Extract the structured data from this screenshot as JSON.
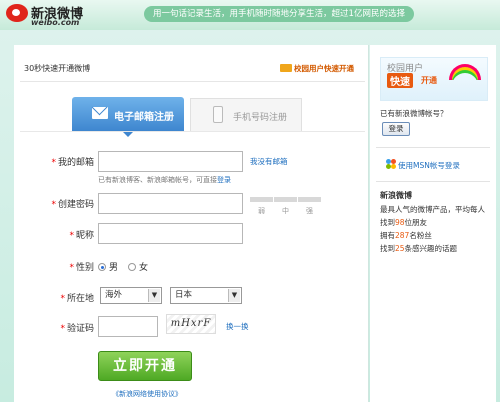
{
  "brand": {
    "name_cn": "新浪微博",
    "domain": "weibo.com",
    "slogan": "用一句话记录生活，用手机随时随地分享生活，超过1亿网民的选择"
  },
  "colors": {
    "accent_blue": "#3e86cf",
    "submit_green": "#4ea924",
    "required_red": "#e00000",
    "link_blue": "#1f6fbf",
    "highlight_orange": "#e85a10"
  },
  "header": {
    "title": "30秒快速开通微博",
    "campus_link": "校园用户快速开通",
    "campus_icon": "flag-icon"
  },
  "tabs": [
    {
      "label": "电子邮箱注册",
      "icon": "envelope-icon",
      "active": true
    },
    {
      "label": "手机号码注册",
      "icon": "mobile-phone-icon",
      "active": false
    }
  ],
  "form": {
    "email": {
      "label": "我的邮箱",
      "value": "",
      "no_email_link": "我没有邮箱",
      "hint": "已有新浪博客、新浪邮箱帐号，可直接",
      "hint_login": "登录"
    },
    "password": {
      "label": "创建密码",
      "value": "",
      "strength": [
        "弱",
        "中",
        "强"
      ]
    },
    "nickname": {
      "label": "昵称",
      "value": ""
    },
    "gender": {
      "label": "性别",
      "options": [
        "男",
        "女"
      ],
      "selected": "男"
    },
    "location": {
      "label": "所在地",
      "region": "海外",
      "country": "日本"
    },
    "captcha": {
      "label": "验证码",
      "value": "",
      "image_text": "mHxrF",
      "refresh_link": "换一换"
    },
    "submit_label": "立即开通",
    "agreement_link": "《新浪网络使用协议》"
  },
  "sidebar": {
    "banner_line1": "校园用户",
    "banner_line2": "快速",
    "banner_line3": "开通",
    "have_account": "已有新浪微博帐号？",
    "login_button": "登录",
    "msn_link": "使用MSN帐号登录",
    "section_title": "新浪微博",
    "desc": "最具人气的微博产品，平均每人",
    "stat1_pre": "找到",
    "stat1_num": "98",
    "stat1_post": "位朋友",
    "stat2_pre": "拥有",
    "stat2_num": "287",
    "stat2_post": "名粉丝",
    "stat3_pre": "找到",
    "stat3_num": "25",
    "stat3_post": "条感兴趣的话题"
  }
}
